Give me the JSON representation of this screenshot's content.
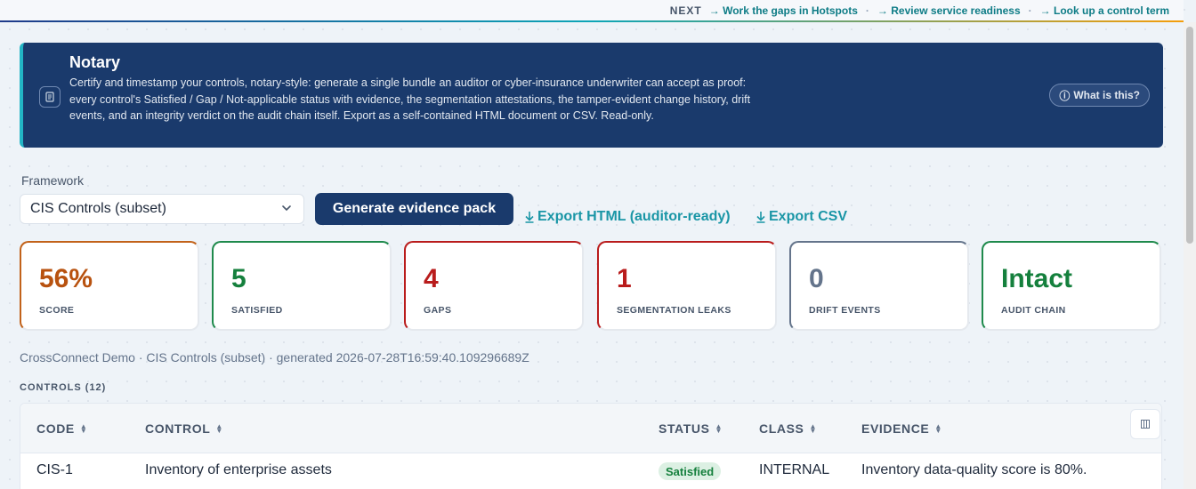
{
  "topbar": {
    "next_label": "NEXT",
    "links": [
      "→ Work the gaps in Hotspots",
      "→ Review service readiness",
      "→ Look up a control term"
    ],
    "separator": "·"
  },
  "banner": {
    "title": "Notary",
    "description": "Certify and timestamp your controls, notary-style: generate a single bundle an auditor or cyber-insurance underwriter can accept as proof: every control's Satisfied / Gap / Not-applicable status with evidence, the segmentation attestations, the tamper-evident change history, drift events, and an integrity verdict on the audit chain itself. Export as a self-contained HTML document or CSV. Read-only.",
    "help_label": "What is this?",
    "icon": "document-icon",
    "help_icon": "info-icon"
  },
  "framework": {
    "label": "Framework",
    "selected": "CIS Controls (subset)"
  },
  "actions": {
    "generate_label": "Generate evidence pack",
    "export_html_label": "Export HTML (auditor-ready)",
    "export_csv_label": "Export CSV"
  },
  "stats": [
    {
      "value": "56%",
      "label": "SCORE",
      "color": "#b8520f",
      "accent": "#c2621a"
    },
    {
      "value": "5",
      "label": "SATISFIED",
      "color": "#15803d",
      "accent": "#1f8a4c"
    },
    {
      "value": "4",
      "label": "GAPS",
      "color": "#b91c1c",
      "accent": "#b91c1c"
    },
    {
      "value": "1",
      "label": "SEGMENTATION LEAKS",
      "color": "#b91c1c",
      "accent": "#b91c1c"
    },
    {
      "value": "0",
      "label": "DRIFT EVENTS",
      "color": "#64748b",
      "accent": "#64748b"
    },
    {
      "value": "Intact",
      "label": "AUDIT CHAIN",
      "color": "#15803d",
      "accent": "#1f8a4c"
    }
  ],
  "meta_line": "CrossConnect Demo · CIS Controls (subset) · generated 2026-07-28T16:59:40.109296689Z",
  "controls": {
    "title": "CONTROLS (12)",
    "columns": [
      "CODE",
      "CONTROL",
      "STATUS",
      "CLASS",
      "EVIDENCE"
    ],
    "rows": [
      {
        "code": "CIS-1",
        "control": "Inventory of enterprise assets",
        "status": "Satisfied",
        "class": "INTERNAL",
        "evidence": "Inventory data-quality score is 80%."
      }
    ]
  },
  "colors": {
    "banner_bg": "#1a3a6c",
    "link": "#1a96a6",
    "primary_button": "#1a3a6c"
  }
}
